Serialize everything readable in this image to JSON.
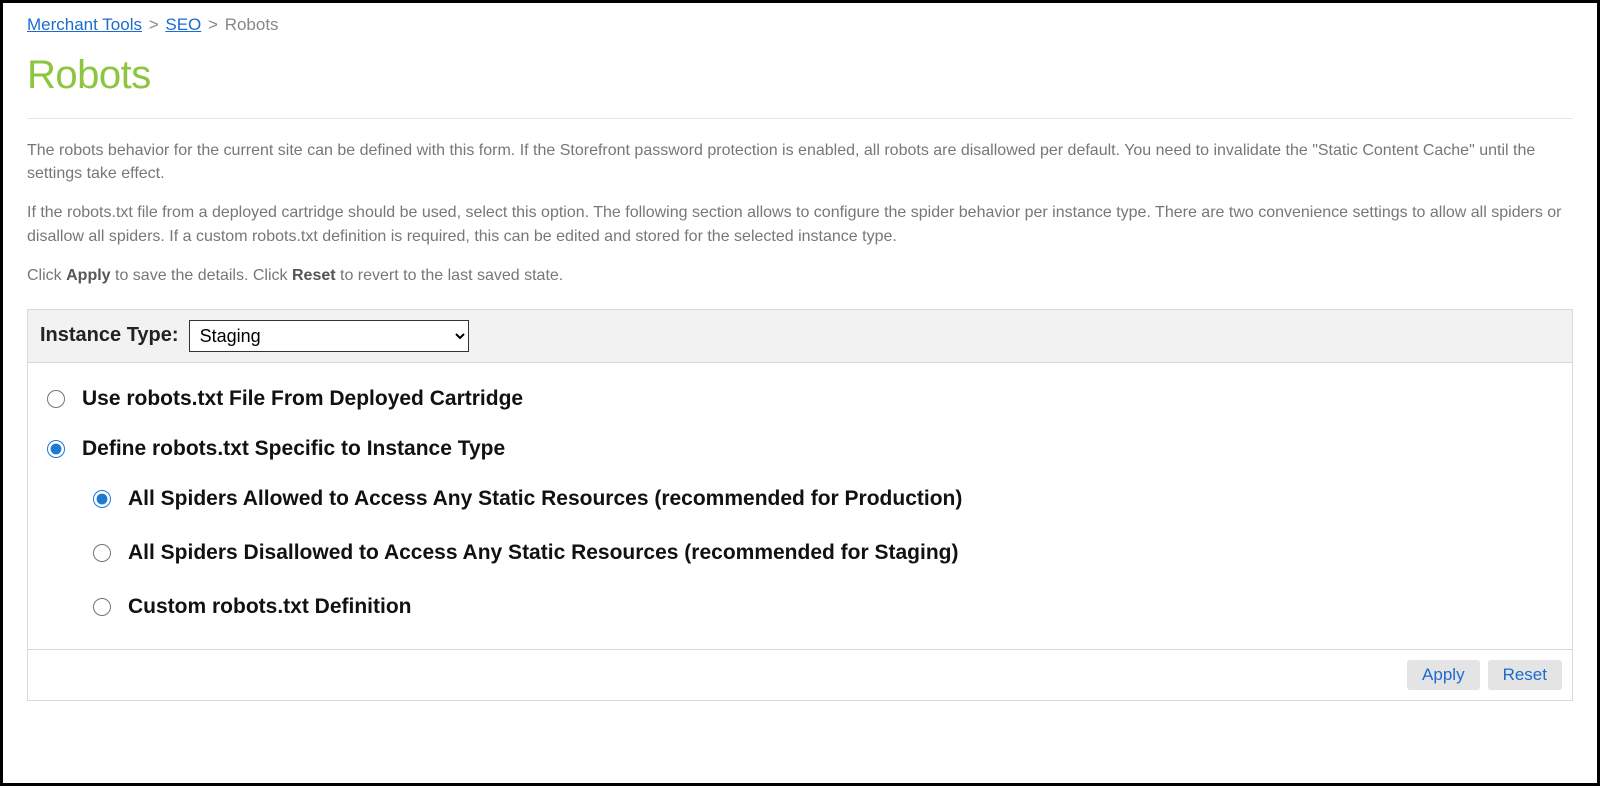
{
  "breadcrumb": {
    "items": [
      {
        "label": "Merchant Tools",
        "link": true
      },
      {
        "label": "SEO",
        "link": true
      },
      {
        "label": "Robots",
        "link": false
      }
    ],
    "separator": ">"
  },
  "title": "Robots",
  "intro": {
    "p1": "The robots behavior for the current site can be defined with this form. If the Storefront password protection is enabled, all robots are disallowed per default. You need to invalidate the \"Static Content Cache\" until the settings take effect.",
    "p2": "If the robots.txt file from a deployed cartridge should be used, select this option. The following section allows to configure the spider behavior per instance type. There are two convenience settings to allow all spiders or disallow all spiders. If a custom robots.txt definition is required, this can be edited and stored for the selected instance type.",
    "p3_pre": "Click ",
    "p3_apply": "Apply",
    "p3_mid": " to save the details. Click ",
    "p3_reset": "Reset",
    "p3_post": " to revert to the last saved state."
  },
  "form": {
    "instance_type_label": "Instance Type:",
    "instance_type_value": "Staging",
    "options": {
      "use_cartridge": {
        "label": "Use robots.txt File From Deployed Cartridge",
        "checked": false
      },
      "define_specific": {
        "label": "Define robots.txt Specific to Instance Type",
        "checked": true,
        "sub": {
          "allow_all": {
            "label": "All Spiders Allowed to Access Any Static Resources (recommended for Production)",
            "checked": true
          },
          "disallow_all": {
            "label": "All Spiders Disallowed to Access Any Static Resources (recommended for Staging)",
            "checked": false
          },
          "custom": {
            "label": "Custom robots.txt Definition",
            "checked": false
          }
        }
      }
    }
  },
  "buttons": {
    "apply": "Apply",
    "reset": "Reset"
  }
}
